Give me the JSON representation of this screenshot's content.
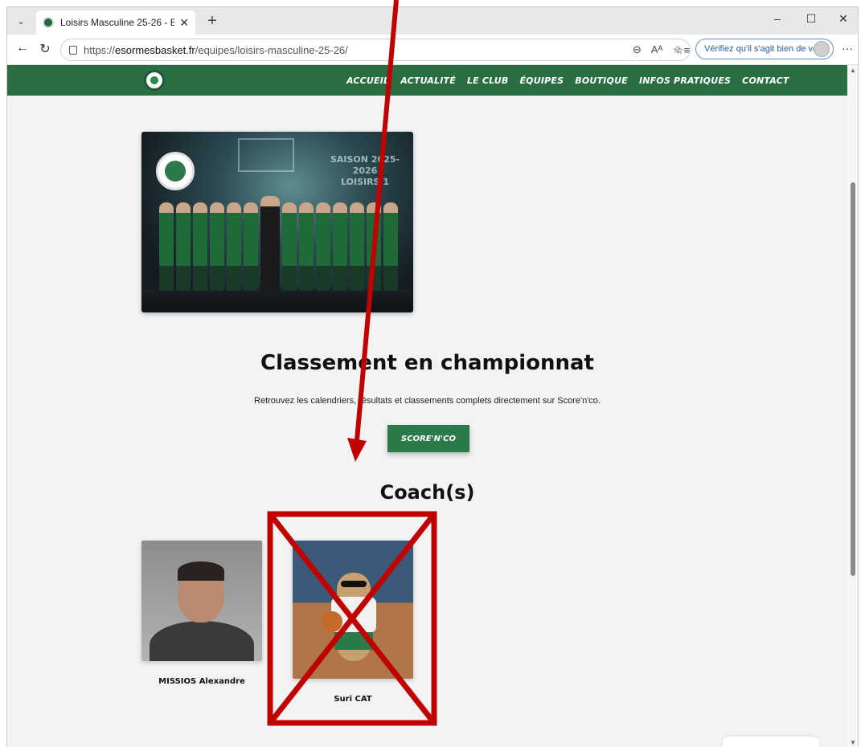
{
  "browser": {
    "tab_title": "Loisirs Masculine 25-26 - ESO Bask",
    "tab_close": "✕",
    "new_tab": "+",
    "url_prefix": "https://",
    "url_domain": "esormesbasket.fr",
    "url_path": "/equipes/loisirs-masculine-25-26/",
    "verify_label": "Vérifiez qu'il s'agit bien de vous"
  },
  "site": {
    "menu": [
      "ACCUEIL",
      "ACTUALITÉ",
      "LE CLUB",
      "ÉQUIPES",
      "BOUTIQUE",
      "INFOS PRATIQUES",
      "CONTACT"
    ]
  },
  "page": {
    "team_photo_text_line1": "SAISON 2025-2026",
    "team_photo_text_line2": "LOISIRS 1",
    "classement_title": "Classement en championnat",
    "classement_desc": "Retrouvez les calendriers, résultats et classements complets directement sur Score'n'co.",
    "score_button": "SCORE'N'CO",
    "coach_title": "Coach(s)",
    "coaches": [
      {
        "name": "MISSIOS Alexandre"
      },
      {
        "name": "Suri CAT"
      }
    ]
  },
  "colors": {
    "brand_green": "#2b6e44",
    "annotation_red": "#c00000"
  }
}
